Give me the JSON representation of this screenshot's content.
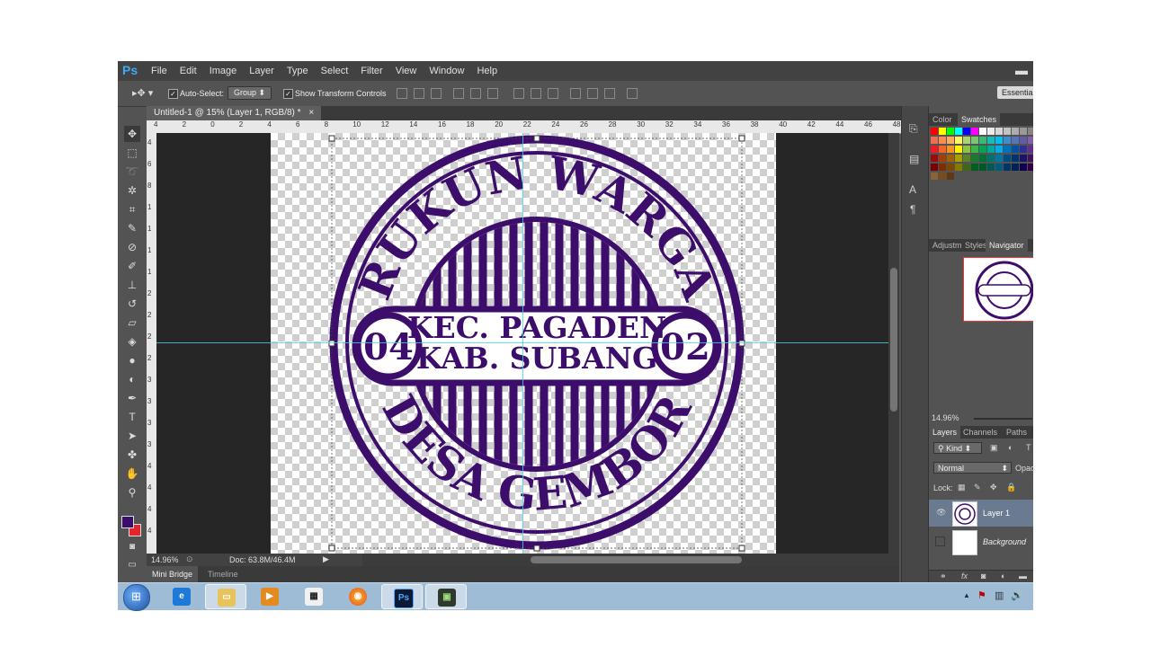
{
  "app": {
    "logo": "Ps",
    "menu": [
      "File",
      "Edit",
      "Image",
      "Layer",
      "Type",
      "Select",
      "Filter",
      "View",
      "Window",
      "Help"
    ],
    "minimize": "▬"
  },
  "options": {
    "auto_select_label": "Auto-Select:",
    "group_value": "Group",
    "show_transform_label": "Show Transform Controls",
    "workspace": "Essentials"
  },
  "document": {
    "tab_title": "Untitled-1 @ 15% (Layer 1, RGB/8) *",
    "close": "×",
    "stamp_top_text": "RUKUN WARGA",
    "stamp_bottom_text": "DESA GEMBOR",
    "stamp_line1": "KEC. PAGADEN",
    "stamp_line2": "KAB. SUBANG",
    "stamp_left": "04",
    "stamp_right": "02",
    "stamp_color": "#3d0d6b"
  },
  "rulers": {
    "top": [
      "4",
      "2",
      "0",
      "2",
      "4",
      "6",
      "8",
      "10",
      "12",
      "14",
      "16",
      "18",
      "20",
      "22",
      "24",
      "26",
      "28",
      "30",
      "32",
      "34",
      "36",
      "38",
      "40",
      "42",
      "44",
      "46",
      "48"
    ],
    "left": [
      "4",
      "6",
      "8",
      "1",
      "1",
      "1",
      "1",
      "2",
      "2",
      "2",
      "2",
      "3",
      "3",
      "3",
      "3",
      "4",
      "4",
      "4",
      "4"
    ]
  },
  "status": {
    "zoom": "14.96%",
    "doc": "Doc: 63.8M/46.4M"
  },
  "bottom_tabs": [
    "Mini Bridge",
    "Timeline"
  ],
  "color_panel": {
    "tabs": [
      "Color",
      "Swatches"
    ]
  },
  "navigator_panel": {
    "tabs": [
      "Adjustm",
      "Styles",
      "Navigator"
    ],
    "zoom": "14.96%"
  },
  "layers_panel": {
    "tabs": [
      "Layers",
      "Channels",
      "Paths"
    ],
    "kind": "Kind",
    "blend_mode": "Normal",
    "opacity_label": "Opac",
    "lock_label": "Lock:",
    "layers": [
      {
        "name": "Layer 1",
        "selected": true
      },
      {
        "name": "Background",
        "selected": false
      }
    ],
    "footer_icons": [
      "link-icon",
      "fx-icon",
      "mask-icon",
      "adjustment-icon",
      "folder-icon"
    ]
  },
  "colors": {
    "foreground": "#3d0d6b",
    "background": "#e3262a",
    "guide": "#47d6f0"
  }
}
